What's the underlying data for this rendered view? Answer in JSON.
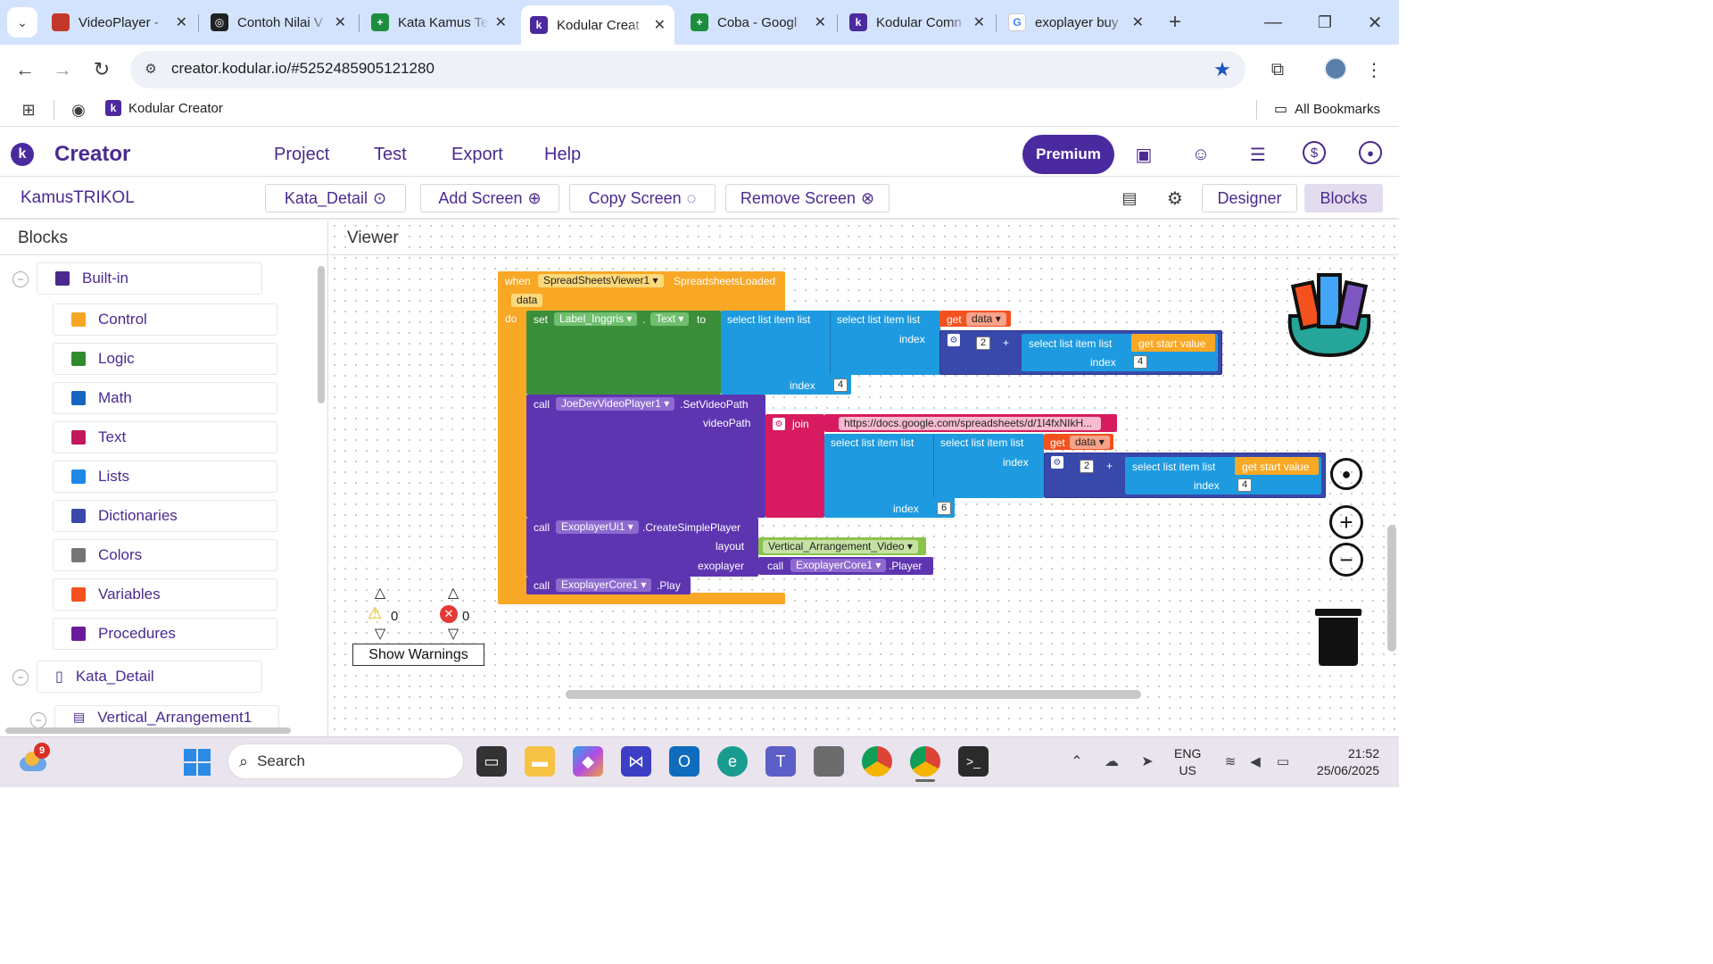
{
  "browser": {
    "tabs": [
      {
        "title": "VideoPlayer -",
        "fav_color": "#c0392b",
        "fav": ""
      },
      {
        "title": "Contoh Nilai V",
        "fav_color": "#202124",
        "fav": "◎"
      },
      {
        "title": "Kata Kamus Te",
        "fav_color": "#1e8e3e",
        "fav": "+"
      },
      {
        "title": "Kodular Creat",
        "fav_color": "#4b2aa0",
        "fav": "k"
      },
      {
        "title": "Coba - Googl",
        "fav_color": "#1e8e3e",
        "fav": "+"
      },
      {
        "title": "Kodular Comn",
        "fav_color": "#4b2aa0",
        "fav": "k"
      },
      {
        "title": "exoplayer buy",
        "fav_color": "#ffffff",
        "fav": "G"
      }
    ],
    "url": "creator.kodular.io/#5252485905121280",
    "bookmark": "Kodular Creator",
    "all_bookmarks": "All Bookmarks"
  },
  "app": {
    "brand": "Creator",
    "menu": [
      "Project",
      "Test",
      "Export",
      "Help"
    ],
    "premium": "Premium",
    "project_name": "KamusTRIKOL",
    "screen_select": "Kata_Detail",
    "add_screen": "Add Screen",
    "copy_screen": "Copy Screen",
    "remove_screen": "Remove Screen",
    "designer": "Designer",
    "blocks": "Blocks"
  },
  "blocks_panel": {
    "title": "Blocks",
    "builtin": "Built-in",
    "items": [
      {
        "label": "Control",
        "color": "#f5a623"
      },
      {
        "label": "Logic",
        "color": "#2e8b2e"
      },
      {
        "label": "Math",
        "color": "#1565c0"
      },
      {
        "label": "Text",
        "color": "#c2185b"
      },
      {
        "label": "Lists",
        "color": "#1e88e5"
      },
      {
        "label": "Dictionaries",
        "color": "#3949ab"
      },
      {
        "label": "Colors",
        "color": "#757575"
      },
      {
        "label": "Variables",
        "color": "#f4511e"
      },
      {
        "label": "Procedures",
        "color": "#6a1b9a"
      }
    ],
    "screen": "Kata_Detail",
    "child": "Vertical_Arrangement1"
  },
  "viewer": {
    "title": "Viewer",
    "warnings_count": "0",
    "errors_count": "0",
    "show_warnings": "Show Warnings"
  },
  "code": {
    "when": "when",
    "component": "SpreadSheetsViewer1",
    "event": "SpreadsheetsLoaded",
    "param": "data",
    "do": "do",
    "set": "set",
    "label": "Label_Inggris",
    "prop": "Text",
    "to": "to",
    "sli": "select list item  list",
    "index": "index",
    "get": "get",
    "data": "data",
    "plus": "+",
    "get_start": "get start value",
    "n2": "2",
    "n4": "4",
    "n6": "6",
    "call": "call",
    "video_comp": "JoeDevVideoPlayer1",
    "set_video": "SetVideoPath",
    "video_path": "videoPath",
    "join": "join",
    "url_text": "https://docs.google.com/spreadsheets/d/1I4fxNIkH...",
    "ui_comp": "ExoplayerUi1",
    "create": "CreateSimplePlayer",
    "layout": "layout",
    "layout_val": "Vertical_Arrangement_Video",
    "exoplayer": "exoplayer",
    "core_comp": "ExoplayerCore1",
    "player": "Player",
    "play": "Play",
    "dot": "."
  },
  "taskbar": {
    "search": "Search",
    "weather_badge": "9",
    "lang": "ENG",
    "region": "US",
    "time": "21:52",
    "date": "25/06/2025"
  }
}
